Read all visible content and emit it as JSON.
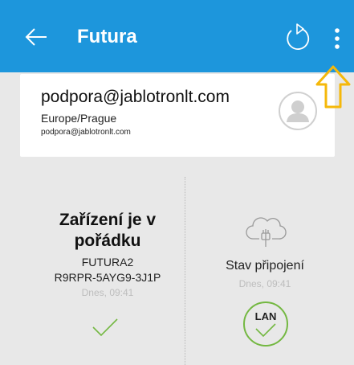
{
  "appbar": {
    "title": "Futura",
    "back_icon": "arrow-left-icon",
    "refresh_icon": "refresh-icon",
    "menu_icon": "more-vert-icon",
    "bg_color": "#1d96dc"
  },
  "account": {
    "email": "podpora@jablotronlt.com",
    "timezone": "Europe/Prague",
    "email_small": "podpora@jablotronlt.com",
    "avatar_icon": "user-avatar-icon"
  },
  "annotation": {
    "arrow_icon": "arrow-up-outline-icon",
    "color": "#f5b80a"
  },
  "device_status": {
    "title": "Zařízení je v pořádku",
    "name": "FUTURA2",
    "code": "R9RPR-5AYG9-3J1P",
    "time": "Dnes, 09:41",
    "check_icon": "check-icon",
    "ok_color": "#74b842"
  },
  "connection_status": {
    "icon": "cloud-plug-icon",
    "label": "Stav připojení",
    "time": "Dnes, 09:41",
    "badge": "LAN",
    "ok_color": "#74b842"
  }
}
